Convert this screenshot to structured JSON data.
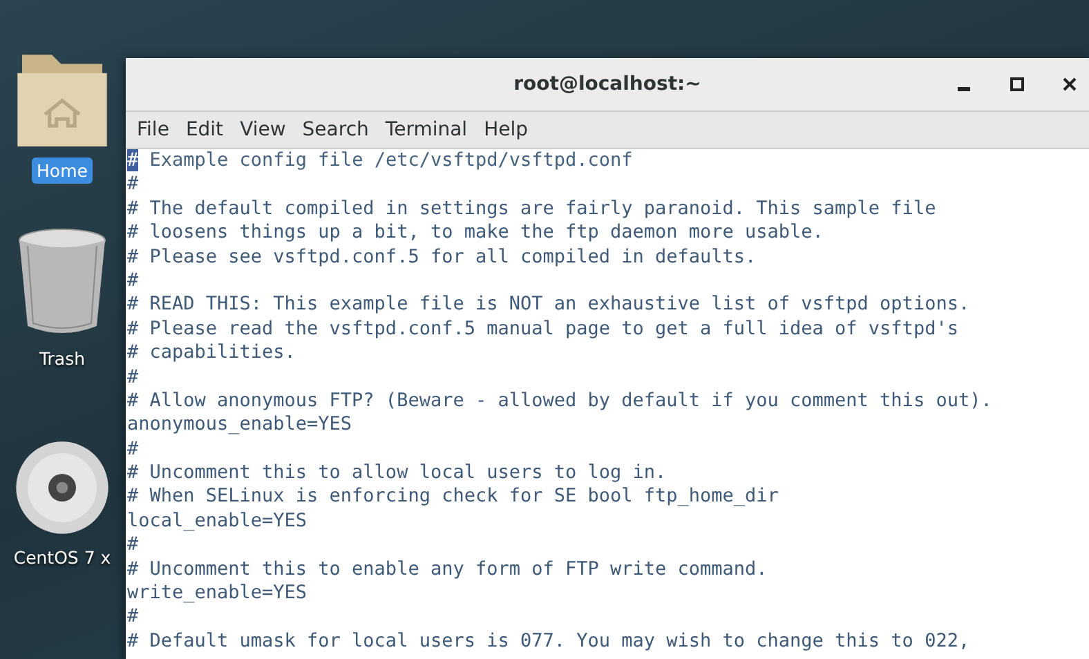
{
  "desktop": {
    "icons": [
      {
        "kind": "folder",
        "label": "Home",
        "selected": true
      },
      {
        "kind": "trash",
        "label": "Trash",
        "selected": false
      },
      {
        "kind": "disc",
        "label": "CentOS 7 x",
        "selected": false
      }
    ]
  },
  "window": {
    "title": "root@localhost:~"
  },
  "menu": [
    "File",
    "Edit",
    "View",
    "Search",
    "Terminal",
    "Help"
  ],
  "terminal": {
    "lines": [
      {
        "text": "# Example config file /etc/vsftpd/vsftpd.conf",
        "cursor": true
      },
      {
        "text": "#",
        "cursor": false
      },
      {
        "text": "# The default compiled in settings are fairly paranoid. This sample file",
        "cursor": false
      },
      {
        "text": "# loosens things up a bit, to make the ftp daemon more usable.",
        "cursor": false
      },
      {
        "text": "# Please see vsftpd.conf.5 for all compiled in defaults.",
        "cursor": false
      },
      {
        "text": "#",
        "cursor": false
      },
      {
        "text": "# READ THIS: This example file is NOT an exhaustive list of vsftpd options.",
        "cursor": false
      },
      {
        "text": "# Please read the vsftpd.conf.5 manual page to get a full idea of vsftpd's",
        "cursor": false
      },
      {
        "text": "# capabilities.",
        "cursor": false
      },
      {
        "text": "#",
        "cursor": false
      },
      {
        "text": "# Allow anonymous FTP? (Beware - allowed by default if you comment this out).",
        "cursor": false
      },
      {
        "text": "anonymous_enable=YES",
        "cursor": false
      },
      {
        "text": "#",
        "cursor": false
      },
      {
        "text": "# Uncomment this to allow local users to log in.",
        "cursor": false
      },
      {
        "text": "# When SELinux is enforcing check for SE bool ftp_home_dir",
        "cursor": false
      },
      {
        "text": "local_enable=YES",
        "cursor": false
      },
      {
        "text": "#",
        "cursor": false
      },
      {
        "text": "# Uncomment this to enable any form of FTP write command.",
        "cursor": false
      },
      {
        "text": "write_enable=YES",
        "cursor": false
      },
      {
        "text": "#",
        "cursor": false
      },
      {
        "text": "# Default umask for local users is 077. You may wish to change this to 022,",
        "cursor": false
      }
    ]
  }
}
